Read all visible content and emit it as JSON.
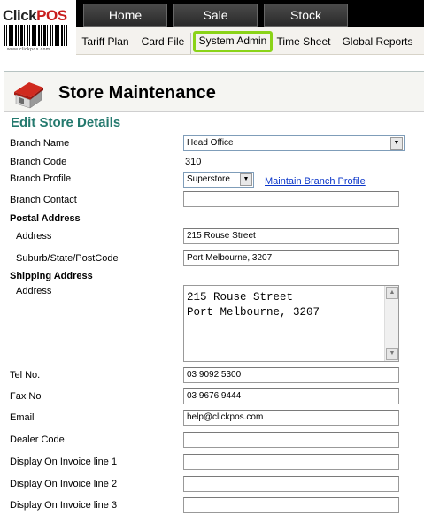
{
  "logo": {
    "brand_click": "Click",
    "brand_pos": "POS",
    "url": "www.clickpos.com"
  },
  "topnav": [
    {
      "label": "Home"
    },
    {
      "label": "Sale"
    },
    {
      "label": "Stock"
    }
  ],
  "subnav": [
    {
      "label": "Tariff Plan"
    },
    {
      "label": "Card File"
    },
    {
      "label": "System Admin"
    },
    {
      "label": "Time Sheet"
    },
    {
      "label": "Global Reports"
    }
  ],
  "page": {
    "title": "Store Maintenance",
    "section": "Edit Store Details"
  },
  "form": {
    "branch_name": {
      "label": "Branch Name",
      "value": "Head Office"
    },
    "branch_code": {
      "label": "Branch Code",
      "value": "310"
    },
    "branch_profile": {
      "label": "Branch Profile",
      "value": "Superstore",
      "link": "Maintain Branch Profile"
    },
    "branch_contact": {
      "label": "Branch Contact",
      "value": ""
    },
    "postal_heading": "Postal Address",
    "postal_address": {
      "label": "Address",
      "value": "215 Rouse Street"
    },
    "postal_suburb": {
      "label": "Suburb/State/PostCode",
      "value": "Port Melbourne, 3207"
    },
    "shipping_heading": "Shipping Address",
    "shipping_address": {
      "label": "Address",
      "value": "215 Rouse Street\nPort Melbourne, 3207"
    },
    "tel": {
      "label": "Tel No.",
      "value": "03 9092 5300"
    },
    "fax": {
      "label": "Fax No",
      "value": "03 9676 9444"
    },
    "email": {
      "label": "Email",
      "value": "help@clickpos.com"
    },
    "dealer_code": {
      "label": "Dealer Code",
      "value": ""
    },
    "invoice_line1": {
      "label": "Display On Invoice line 1",
      "value": ""
    },
    "invoice_line2": {
      "label": "Display On Invoice line 2",
      "value": ""
    },
    "invoice_line3": {
      "label": "Display On Invoice line 3",
      "value": ""
    }
  },
  "icons": {
    "store": "store-icon",
    "dropdown": "chevron-down-icon",
    "scroll_up": "arrow-up-icon",
    "scroll_down": "arrow-down-icon"
  },
  "colors": {
    "section_title": "#24796e",
    "active_tab_border": "#8ad318",
    "link": "#0a35c9",
    "nav_bg": "#000000"
  }
}
